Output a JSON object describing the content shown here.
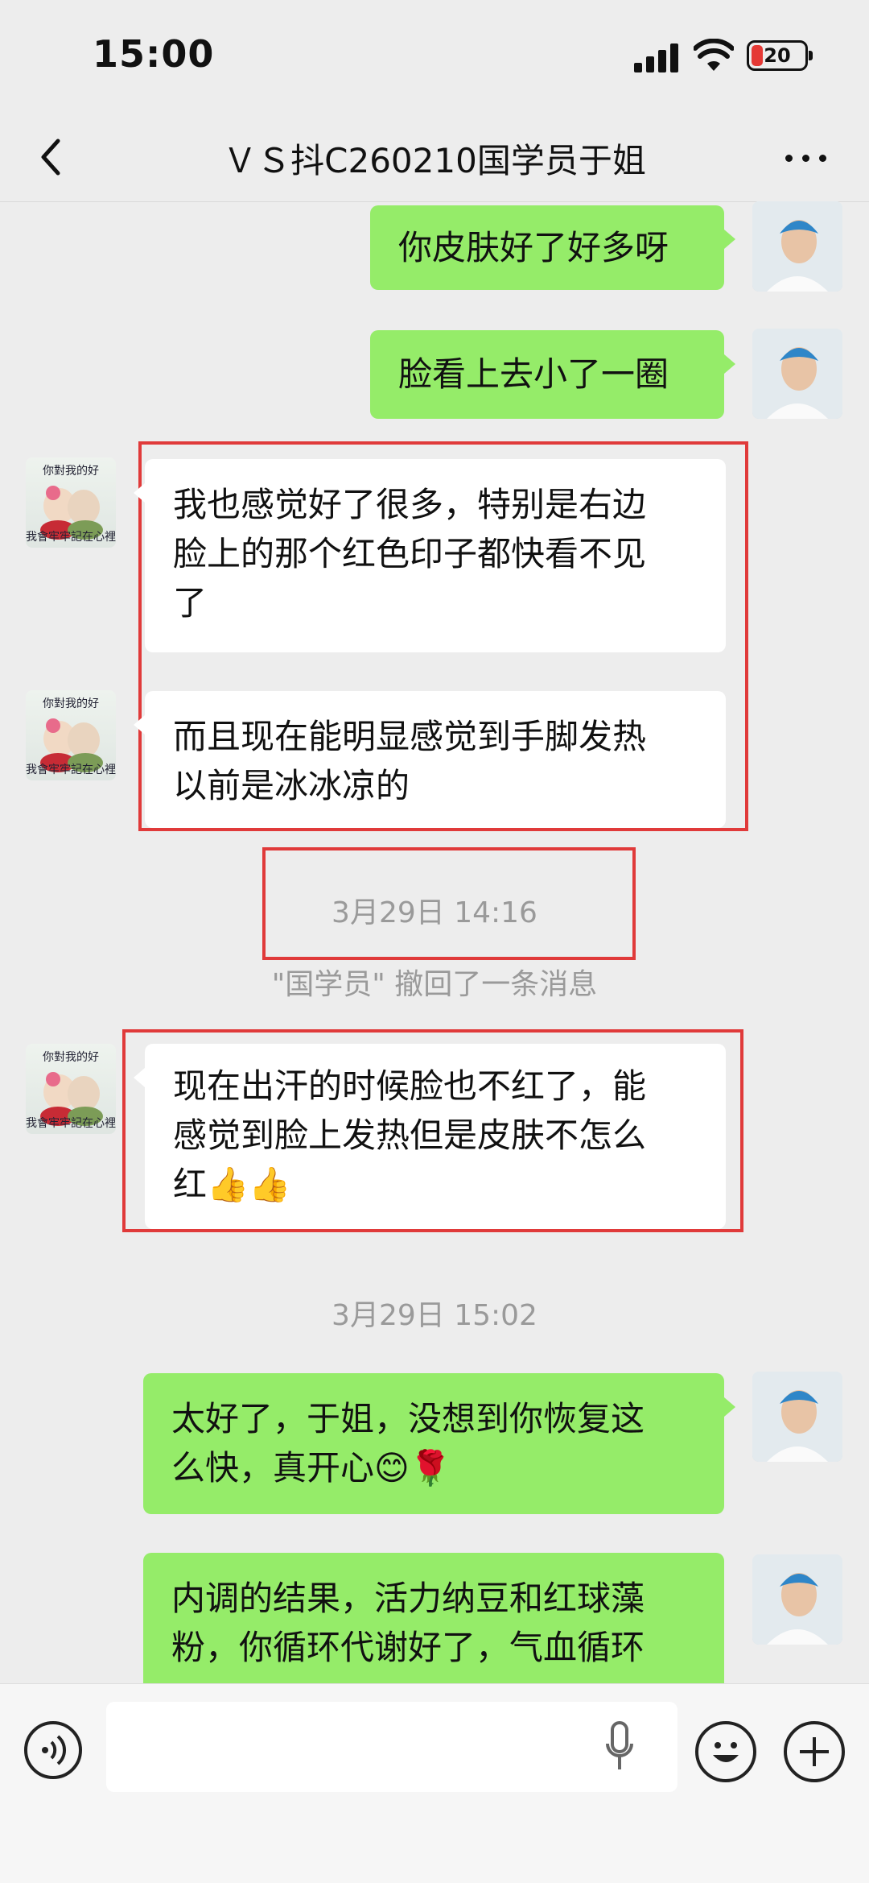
{
  "status_bar": {
    "time": "15:00",
    "battery_level": "20",
    "icons": [
      "signal-icon",
      "wifi-icon",
      "battery-icon"
    ]
  },
  "header": {
    "title": "ＶＳ抖C260210国学员于姐",
    "back_icon": "chevron-left-icon",
    "more_icon": "more-dots-icon"
  },
  "messages": [
    {
      "side": "right",
      "text": "你皮肤好了好多呀"
    },
    {
      "side": "right",
      "text": "脸看上去小了一圈"
    },
    {
      "side": "left",
      "text": "我也感觉好了很多，特别是右边\n脸上的那个红色印子都快看不见\n了"
    },
    {
      "side": "left",
      "text": "而且现在能明显感觉到手脚发热\n以前是冰冰凉的"
    },
    {
      "side": "left",
      "text": "现在出汗的时候脸也不红了，能\n感觉到脸上发热但是皮肤不怎么\n红👍👍"
    },
    {
      "side": "right",
      "text": "太好了，于姐，没想到你恢复这\n么快，真开心😊🌹"
    },
    {
      "side": "right",
      "text": "内调的结果，活力纳豆和红球藻\n粉，你循环代谢好了，气血循环"
    }
  ],
  "timestamps": [
    "3月29日 14:16",
    "3月29日 15:02"
  ],
  "system_message": "\"国学员\" 撤回了一条消息",
  "avatar_user_caption": {
    "top": "你對我的好",
    "bottom": "我會牢牢記在心裡"
  },
  "colors": {
    "background": "#ededed",
    "sent_bubble": "#95ec69",
    "received_bubble": "#ffffff",
    "highlight_box": "#e03a3a"
  },
  "input_bar": {
    "placeholder": "",
    "icons": [
      "voice-icon",
      "microphone-icon",
      "emoji-icon",
      "plus-icon"
    ]
  }
}
